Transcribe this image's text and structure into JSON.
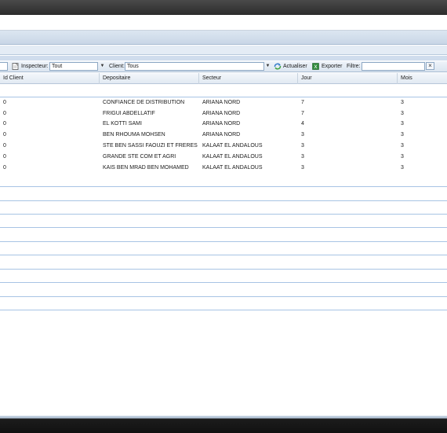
{
  "toolbar": {
    "inspecteur_label": "Inspecteur:",
    "inspecteur_value": "Tout",
    "client_label": "Client:",
    "client_value": "Tous",
    "refresh_label": "Actualiser",
    "export_label": "Exporter",
    "filter_label": "Filtre:",
    "filter_value": "",
    "clear_glyph": "×"
  },
  "columns": [
    "Id Client",
    "Depositaire",
    "Secteur",
    "Jour",
    "Mois"
  ],
  "rows": [
    {
      "id_client": "0",
      "depositaire": "CONFIANCE DE DISTRIBUTION",
      "secteur": "ARIANA NORD",
      "jour": "7",
      "mois": "3"
    },
    {
      "id_client": "0",
      "depositaire": "FRIGUI ABDELLATIF",
      "secteur": "ARIANA NORD",
      "jour": "7",
      "mois": "3"
    },
    {
      "id_client": "0",
      "depositaire": "EL KOTTI SAMI",
      "secteur": "ARIANA NORD",
      "jour": "4",
      "mois": "3"
    },
    {
      "id_client": "0",
      "depositaire": "BEN RHOUMA MOHSEN",
      "secteur": "ARIANA NORD",
      "jour": "3",
      "mois": "3"
    },
    {
      "id_client": "0",
      "depositaire": "STE BEN SASSI FAOUZI ET FRERES",
      "secteur": "KALAAT EL ANDALOUS",
      "jour": "3",
      "mois": "3"
    },
    {
      "id_client": "0",
      "depositaire": "GRANDE STE COM ET AGRI",
      "secteur": "KALAAT EL ANDALOUS",
      "jour": "3",
      "mois": "3"
    },
    {
      "id_client": "0",
      "depositaire": "KAIS BEN MRAD BEN MOHAMED",
      "secteur": "KALAAT EL ANDALOUS",
      "jour": "3",
      "mois": "3"
    }
  ],
  "icons": {
    "inspector": "document-icon",
    "dropdown": "chevron-down-icon",
    "refresh": "refresh-icon",
    "export": "excel-export-icon",
    "clear": "close-icon"
  },
  "colors": {
    "accent": "#a8c4e4",
    "header_band": "#c8d6e6",
    "dark_chrome": "#2c2c2c"
  }
}
